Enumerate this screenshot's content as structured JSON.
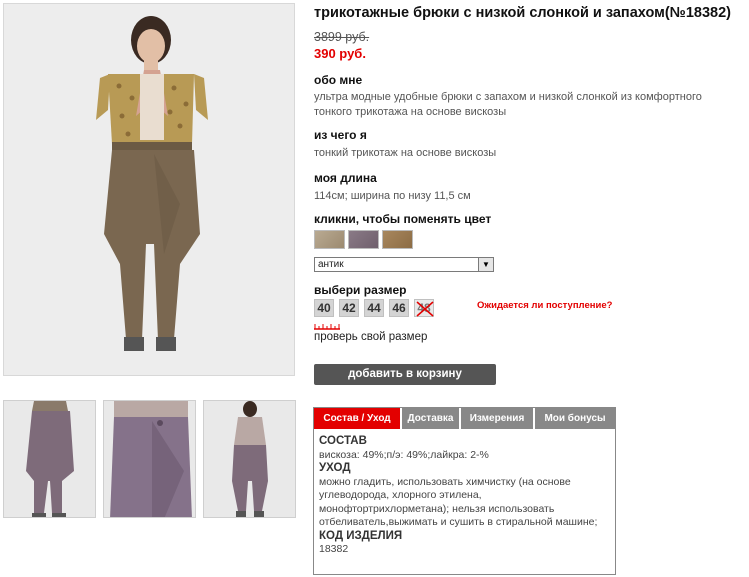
{
  "product": {
    "title": "трикотажные брюки с низкой слонкой и запахом(№18382)",
    "old_price": "3899 руб.",
    "new_price": "390 руб."
  },
  "about": {
    "label": "обо мне",
    "text": "ультра модные удобные брюки с запахом и низкой слонкой из комфортного тонкого трикотажа на основе вискозы"
  },
  "material": {
    "label": "из чего я",
    "text": "тонкий трикотаж на основе вискозы"
  },
  "length": {
    "label": "моя длина",
    "text": "114см; ширина по низу 11,5 см"
  },
  "color": {
    "label": "кликни, чтобы поменять цвет",
    "selected": "антик",
    "swatches": [
      "#a9977d",
      "#7c6c79",
      "#9a7a52"
    ]
  },
  "size": {
    "label": "выбери размер",
    "options": [
      "40",
      "42",
      "44",
      "46",
      "48"
    ],
    "notify": "Ожидается ли поступление?",
    "check_link": "проверь свой размер"
  },
  "cart": {
    "button": "добавить в корзину"
  },
  "tabs": {
    "items": [
      "Состав / Уход",
      "Доставка",
      "Измерения",
      "Мои бонусы"
    ],
    "active": "Состав / Уход",
    "content": {
      "composition_title": "СОСТАВ",
      "composition": "вискоза: 49%;п/э: 49%;лайкра: 2-%",
      "care_title": "УХОД",
      "care": "можно гладить, использовать химчистку (на основе углеводорода, хлорного этилена, монофтортрихлорметана); нельзя использовать отбеливатель,выжимать и сушить в стиральной машине;",
      "code_title": "КОД ИЗДЕЛИЯ",
      "code": "18382"
    }
  },
  "colors": {
    "accent": "#e30000",
    "tab_inactive": "#888888",
    "button": "#555555"
  }
}
